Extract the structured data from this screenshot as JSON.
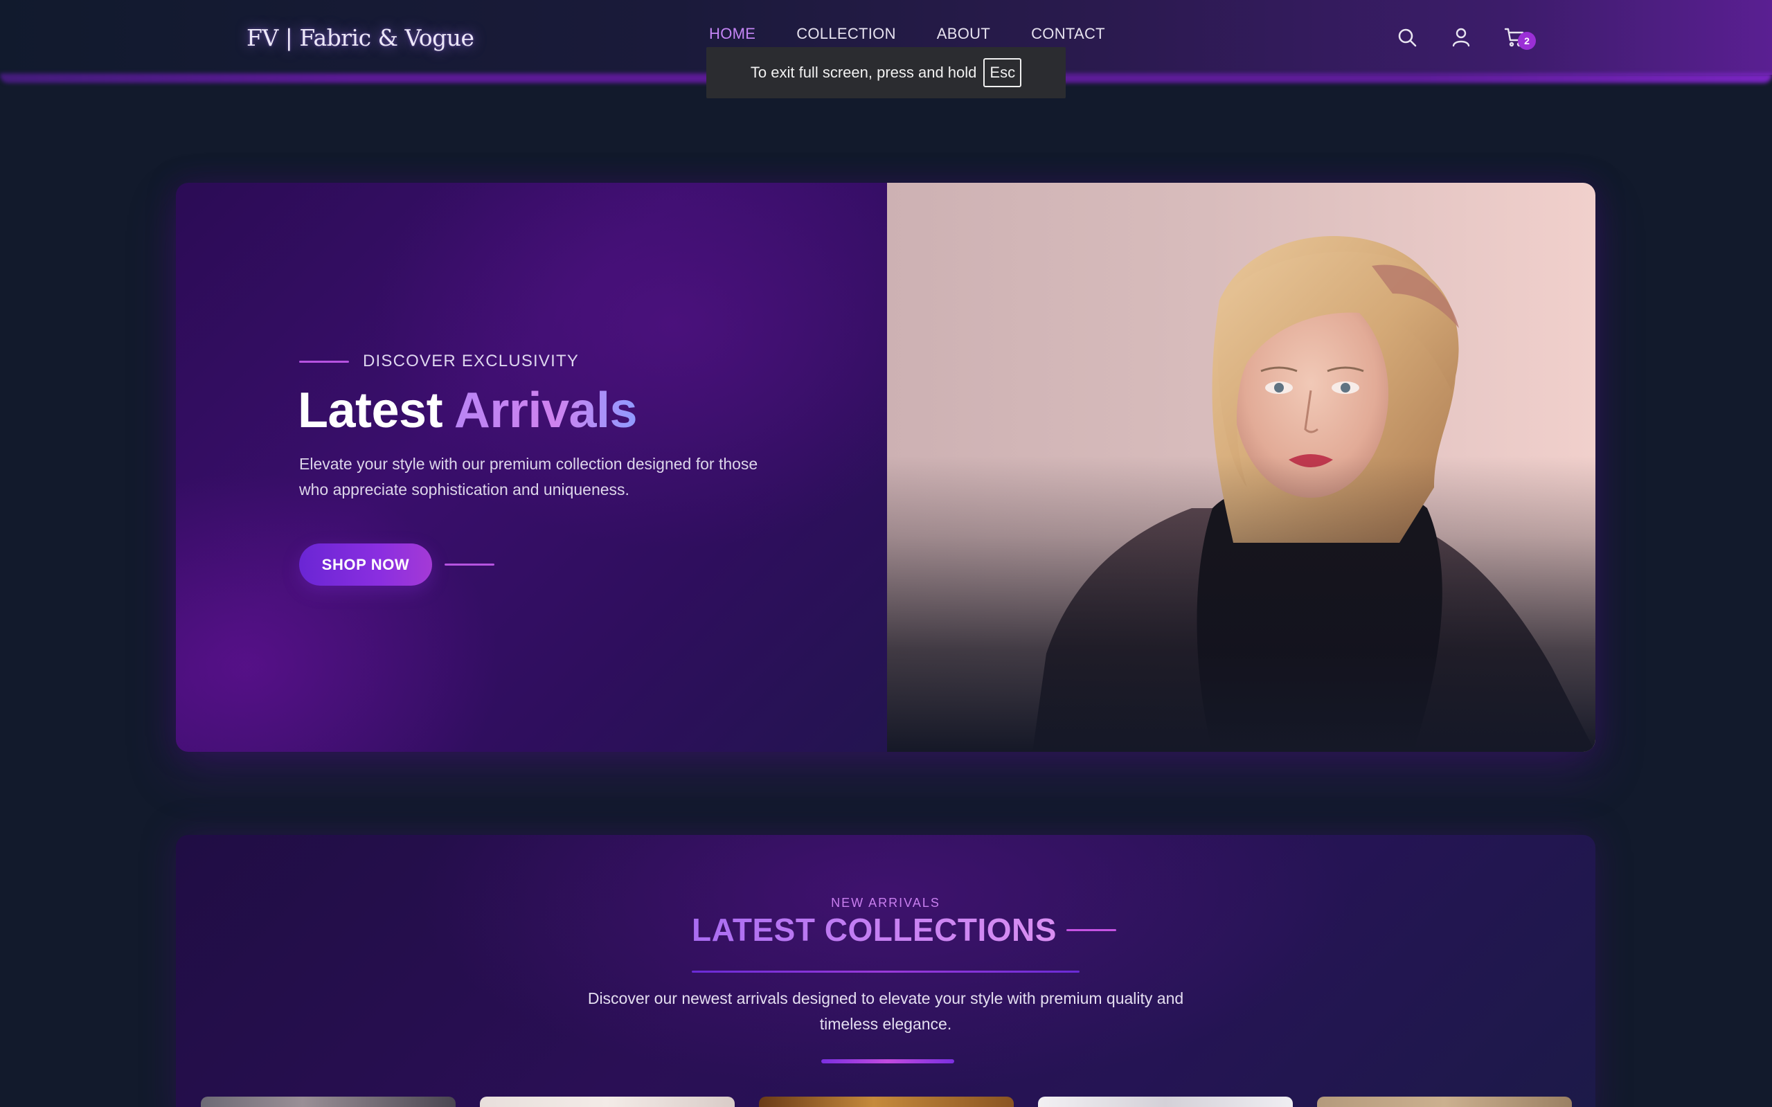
{
  "brand": {
    "logo": "FV | Fabric & Vogue"
  },
  "nav": {
    "links": [
      {
        "label": "HOME",
        "active": true
      },
      {
        "label": "COLLECTION",
        "active": false
      },
      {
        "label": "ABOUT",
        "active": false
      },
      {
        "label": "CONTACT",
        "active": false
      }
    ],
    "icons": [
      "search-icon",
      "user-icon",
      "cart-icon"
    ],
    "cart_count": "2"
  },
  "fullscreen_toast": {
    "message": "To exit full screen, press and hold",
    "key": "Esc"
  },
  "hero": {
    "kicker": "DISCOVER EXCLUSIVITY",
    "title_word_1": "Latest",
    "title_word_2": "Arrivals",
    "description": "Elevate your style with our premium collection designed for those who appreciate sophistication and uniqueness.",
    "cta_label": "SHOP NOW"
  },
  "collections": {
    "kicker": "NEW ARRIVALS",
    "title": "LATEST COLLECTIONS",
    "description": "Discover our newest arrivals designed to elevate your style with premium quality and timeless elegance.",
    "card_count": 5
  },
  "colors": {
    "accent": "#c485f5",
    "background": "#121a2c",
    "cta": "#7b2fe0"
  }
}
